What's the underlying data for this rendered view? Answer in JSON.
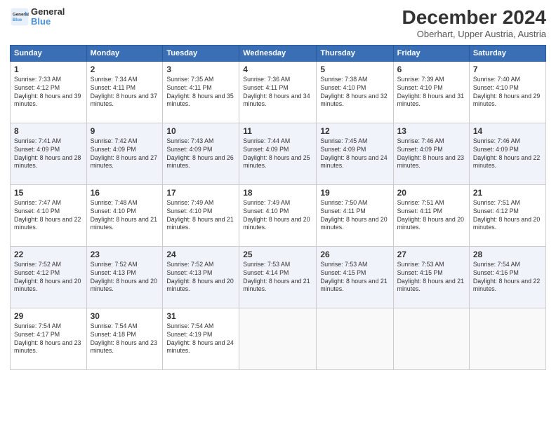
{
  "header": {
    "logo_line1": "General",
    "logo_line2": "Blue",
    "month": "December 2024",
    "location": "Oberhart, Upper Austria, Austria"
  },
  "weekdays": [
    "Sunday",
    "Monday",
    "Tuesday",
    "Wednesday",
    "Thursday",
    "Friday",
    "Saturday"
  ],
  "weeks": [
    [
      {
        "day": "1",
        "sunrise": "Sunrise: 7:33 AM",
        "sunset": "Sunset: 4:12 PM",
        "daylight": "Daylight: 8 hours and 39 minutes."
      },
      {
        "day": "2",
        "sunrise": "Sunrise: 7:34 AM",
        "sunset": "Sunset: 4:11 PM",
        "daylight": "Daylight: 8 hours and 37 minutes."
      },
      {
        "day": "3",
        "sunrise": "Sunrise: 7:35 AM",
        "sunset": "Sunset: 4:11 PM",
        "daylight": "Daylight: 8 hours and 35 minutes."
      },
      {
        "day": "4",
        "sunrise": "Sunrise: 7:36 AM",
        "sunset": "Sunset: 4:11 PM",
        "daylight": "Daylight: 8 hours and 34 minutes."
      },
      {
        "day": "5",
        "sunrise": "Sunrise: 7:38 AM",
        "sunset": "Sunset: 4:10 PM",
        "daylight": "Daylight: 8 hours and 32 minutes."
      },
      {
        "day": "6",
        "sunrise": "Sunrise: 7:39 AM",
        "sunset": "Sunset: 4:10 PM",
        "daylight": "Daylight: 8 hours and 31 minutes."
      },
      {
        "day": "7",
        "sunrise": "Sunrise: 7:40 AM",
        "sunset": "Sunset: 4:10 PM",
        "daylight": "Daylight: 8 hours and 29 minutes."
      }
    ],
    [
      {
        "day": "8",
        "sunrise": "Sunrise: 7:41 AM",
        "sunset": "Sunset: 4:09 PM",
        "daylight": "Daylight: 8 hours and 28 minutes."
      },
      {
        "day": "9",
        "sunrise": "Sunrise: 7:42 AM",
        "sunset": "Sunset: 4:09 PM",
        "daylight": "Daylight: 8 hours and 27 minutes."
      },
      {
        "day": "10",
        "sunrise": "Sunrise: 7:43 AM",
        "sunset": "Sunset: 4:09 PM",
        "daylight": "Daylight: 8 hours and 26 minutes."
      },
      {
        "day": "11",
        "sunrise": "Sunrise: 7:44 AM",
        "sunset": "Sunset: 4:09 PM",
        "daylight": "Daylight: 8 hours and 25 minutes."
      },
      {
        "day": "12",
        "sunrise": "Sunrise: 7:45 AM",
        "sunset": "Sunset: 4:09 PM",
        "daylight": "Daylight: 8 hours and 24 minutes."
      },
      {
        "day": "13",
        "sunrise": "Sunrise: 7:46 AM",
        "sunset": "Sunset: 4:09 PM",
        "daylight": "Daylight: 8 hours and 23 minutes."
      },
      {
        "day": "14",
        "sunrise": "Sunrise: 7:46 AM",
        "sunset": "Sunset: 4:09 PM",
        "daylight": "Daylight: 8 hours and 22 minutes."
      }
    ],
    [
      {
        "day": "15",
        "sunrise": "Sunrise: 7:47 AM",
        "sunset": "Sunset: 4:10 PM",
        "daylight": "Daylight: 8 hours and 22 minutes."
      },
      {
        "day": "16",
        "sunrise": "Sunrise: 7:48 AM",
        "sunset": "Sunset: 4:10 PM",
        "daylight": "Daylight: 8 hours and 21 minutes."
      },
      {
        "day": "17",
        "sunrise": "Sunrise: 7:49 AM",
        "sunset": "Sunset: 4:10 PM",
        "daylight": "Daylight: 8 hours and 21 minutes."
      },
      {
        "day": "18",
        "sunrise": "Sunrise: 7:49 AM",
        "sunset": "Sunset: 4:10 PM",
        "daylight": "Daylight: 8 hours and 20 minutes."
      },
      {
        "day": "19",
        "sunrise": "Sunrise: 7:50 AM",
        "sunset": "Sunset: 4:11 PM",
        "daylight": "Daylight: 8 hours and 20 minutes."
      },
      {
        "day": "20",
        "sunrise": "Sunrise: 7:51 AM",
        "sunset": "Sunset: 4:11 PM",
        "daylight": "Daylight: 8 hours and 20 minutes."
      },
      {
        "day": "21",
        "sunrise": "Sunrise: 7:51 AM",
        "sunset": "Sunset: 4:12 PM",
        "daylight": "Daylight: 8 hours and 20 minutes."
      }
    ],
    [
      {
        "day": "22",
        "sunrise": "Sunrise: 7:52 AM",
        "sunset": "Sunset: 4:12 PM",
        "daylight": "Daylight: 8 hours and 20 minutes."
      },
      {
        "day": "23",
        "sunrise": "Sunrise: 7:52 AM",
        "sunset": "Sunset: 4:13 PM",
        "daylight": "Daylight: 8 hours and 20 minutes."
      },
      {
        "day": "24",
        "sunrise": "Sunrise: 7:52 AM",
        "sunset": "Sunset: 4:13 PM",
        "daylight": "Daylight: 8 hours and 20 minutes."
      },
      {
        "day": "25",
        "sunrise": "Sunrise: 7:53 AM",
        "sunset": "Sunset: 4:14 PM",
        "daylight": "Daylight: 8 hours and 21 minutes."
      },
      {
        "day": "26",
        "sunrise": "Sunrise: 7:53 AM",
        "sunset": "Sunset: 4:15 PM",
        "daylight": "Daylight: 8 hours and 21 minutes."
      },
      {
        "day": "27",
        "sunrise": "Sunrise: 7:53 AM",
        "sunset": "Sunset: 4:15 PM",
        "daylight": "Daylight: 8 hours and 21 minutes."
      },
      {
        "day": "28",
        "sunrise": "Sunrise: 7:54 AM",
        "sunset": "Sunset: 4:16 PM",
        "daylight": "Daylight: 8 hours and 22 minutes."
      }
    ],
    [
      {
        "day": "29",
        "sunrise": "Sunrise: 7:54 AM",
        "sunset": "Sunset: 4:17 PM",
        "daylight": "Daylight: 8 hours and 23 minutes."
      },
      {
        "day": "30",
        "sunrise": "Sunrise: 7:54 AM",
        "sunset": "Sunset: 4:18 PM",
        "daylight": "Daylight: 8 hours and 23 minutes."
      },
      {
        "day": "31",
        "sunrise": "Sunrise: 7:54 AM",
        "sunset": "Sunset: 4:19 PM",
        "daylight": "Daylight: 8 hours and 24 minutes."
      },
      null,
      null,
      null,
      null
    ]
  ]
}
